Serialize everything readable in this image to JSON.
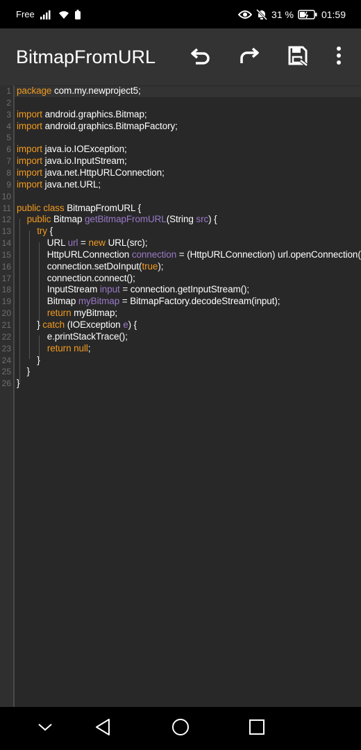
{
  "status_bar": {
    "carrier": "Free",
    "battery_percent": "31 %",
    "time": "01:59",
    "icons": [
      "signal-icon",
      "wifi-icon",
      "battery-small-icon",
      "eye-icon",
      "bell-off-icon",
      "battery-icon"
    ]
  },
  "toolbar": {
    "title": "BitmapFromURL",
    "actions": [
      "undo-icon",
      "redo-icon",
      "save-icon",
      "more-vert-icon"
    ]
  },
  "editor": {
    "line_numbers": [
      "1",
      "2",
      "3",
      "4",
      "5",
      "6",
      "7",
      "8",
      "9",
      "10",
      "11",
      "12",
      "13",
      "14",
      "15",
      "16",
      "17",
      "18",
      "19",
      "20",
      "21",
      "22",
      "23",
      "24",
      "25",
      "26"
    ],
    "lines": [
      [
        [
          "k",
          "package"
        ],
        [
          "t",
          " com.my.newproject5;"
        ]
      ],
      [],
      [
        [
          "k",
          "import"
        ],
        [
          "t",
          " android.graphics.Bitmap;"
        ]
      ],
      [
        [
          "k",
          "import"
        ],
        [
          "t",
          " android.graphics.BitmapFactory;"
        ]
      ],
      [],
      [
        [
          "k",
          "import"
        ],
        [
          "t",
          " java.io.IOException;"
        ]
      ],
      [
        [
          "k",
          "import"
        ],
        [
          "t",
          " java.io.InputStream;"
        ]
      ],
      [
        [
          "k",
          "import"
        ],
        [
          "t",
          " java.net.HttpURLConnection;"
        ]
      ],
      [
        [
          "k",
          "import"
        ],
        [
          "t",
          " java.net.URL;"
        ]
      ],
      [],
      [
        [
          "k",
          "public class"
        ],
        [
          "t",
          " BitmapFromURL {"
        ]
      ],
      [
        [
          "t",
          "    "
        ],
        [
          "k",
          "public"
        ],
        [
          "t",
          " Bitmap "
        ],
        [
          "v",
          "getBitmapFromURL"
        ],
        [
          "t",
          "(String "
        ],
        [
          "v",
          "src"
        ],
        [
          "t",
          ") {"
        ]
      ],
      [
        [
          "t",
          "        "
        ],
        [
          "k",
          "try"
        ],
        [
          "t",
          " {"
        ]
      ],
      [
        [
          "t",
          "            URL "
        ],
        [
          "v",
          "url"
        ],
        [
          "t",
          " = "
        ],
        [
          "k",
          "new"
        ],
        [
          "t",
          " URL(src);"
        ]
      ],
      [
        [
          "t",
          "            HttpURLConnection "
        ],
        [
          "v",
          "connection"
        ],
        [
          "t",
          " = (HttpURLConnection) url.openConnection();"
        ]
      ],
      [
        [
          "t",
          "            connection.setDoInput("
        ],
        [
          "k",
          "true"
        ],
        [
          "t",
          ");"
        ]
      ],
      [
        [
          "t",
          "            connection.connect();"
        ]
      ],
      [
        [
          "t",
          "            InputStream "
        ],
        [
          "v",
          "input"
        ],
        [
          "t",
          " = connection.getInputStream();"
        ]
      ],
      [
        [
          "t",
          "            Bitmap "
        ],
        [
          "v",
          "myBitmap"
        ],
        [
          "t",
          " = BitmapFactory.decodeStream(input);"
        ]
      ],
      [
        [
          "t",
          "            "
        ],
        [
          "k",
          "return"
        ],
        [
          "t",
          " myBitmap;"
        ]
      ],
      [
        [
          "t",
          "        } "
        ],
        [
          "k",
          "catch"
        ],
        [
          "t",
          " (IOException "
        ],
        [
          "v",
          "e"
        ],
        [
          "t",
          ") {"
        ]
      ],
      [
        [
          "t",
          "            e.printStackTrace();"
        ]
      ],
      [
        [
          "t",
          "            "
        ],
        [
          "k",
          "return null"
        ],
        [
          "t",
          ";"
        ]
      ],
      [
        [
          "t",
          "        }"
        ]
      ],
      [
        [
          "t",
          "    }"
        ]
      ],
      [
        [
          "t",
          "}"
        ]
      ]
    ]
  },
  "colors": {
    "keyword": "#f29a1f",
    "variable": "#9a79c8",
    "text": "#ffffff",
    "background": "#282828",
    "toolbar": "#333333"
  },
  "nav_bar": {
    "buttons": [
      "chevron-down-icon",
      "back-icon",
      "home-icon",
      "recents-icon"
    ]
  }
}
